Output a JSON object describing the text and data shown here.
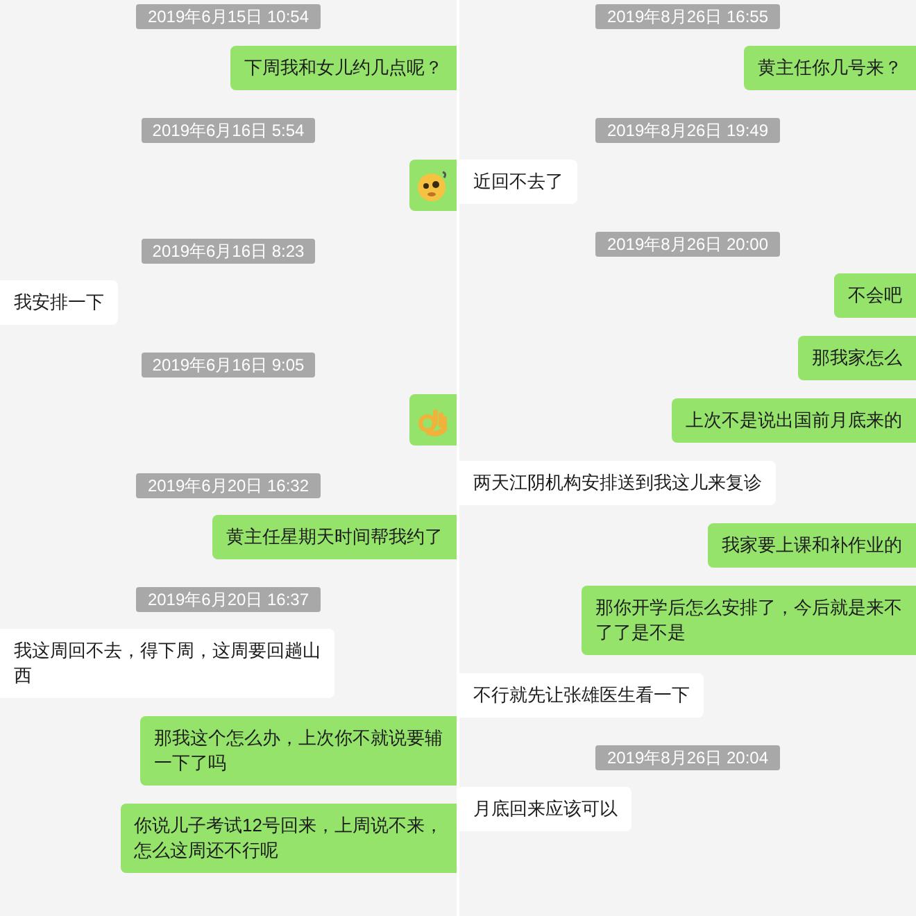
{
  "panels": [
    {
      "messages": [
        {
          "kind": "timestamp",
          "text": "2019年6月15日 10:54"
        },
        {
          "kind": "text",
          "outgoing": true,
          "lines": [
            "下周我和女儿约几点呢？"
          ]
        },
        {
          "kind": "timestamp",
          "text": "2019年6月16日 5:54"
        },
        {
          "kind": "face",
          "outgoing": true
        },
        {
          "kind": "timestamp",
          "text": "2019年6月16日 8:23"
        },
        {
          "kind": "text",
          "outgoing": false,
          "lines": [
            "我安排一下"
          ]
        },
        {
          "kind": "timestamp",
          "text": "2019年6月16日 9:05"
        },
        {
          "kind": "hand",
          "outgoing": true
        },
        {
          "kind": "timestamp",
          "text": "2019年6月20日 16:32"
        },
        {
          "kind": "text",
          "outgoing": true,
          "lines": [
            "黄主任星期天时间帮我约了"
          ]
        },
        {
          "kind": "timestamp",
          "text": "2019年6月20日 16:37"
        },
        {
          "kind": "text",
          "outgoing": false,
          "lines": [
            "我这周回不去，得下周，这周要回趟山",
            "西"
          ]
        },
        {
          "kind": "text",
          "outgoing": true,
          "lines": [
            "那我这个怎么办，上次你不就说要辅",
            "一下了吗"
          ]
        },
        {
          "kind": "text",
          "outgoing": true,
          "lines": [
            "你说儿子考试12号回来，上周说不来，",
            "怎么这周还不行呢"
          ]
        }
      ]
    },
    {
      "messages": [
        {
          "kind": "timestamp",
          "text": "2019年8月26日 16:55"
        },
        {
          "kind": "text",
          "outgoing": true,
          "lines": [
            "黄主任你几号来？"
          ]
        },
        {
          "kind": "timestamp",
          "text": "2019年8月26日 19:49"
        },
        {
          "kind": "text",
          "outgoing": false,
          "lines": [
            "近回不去了"
          ]
        },
        {
          "kind": "timestamp",
          "text": "2019年8月26日 20:00"
        },
        {
          "kind": "text",
          "outgoing": true,
          "lines": [
            "不会吧"
          ]
        },
        {
          "kind": "text",
          "outgoing": true,
          "lines": [
            "那我家怎么"
          ]
        },
        {
          "kind": "text",
          "outgoing": true,
          "lines": [
            "上次不是说出国前月底来的"
          ]
        },
        {
          "kind": "text",
          "outgoing": false,
          "lines": [
            "两天江阴机构安排送到我这儿来复诊"
          ]
        },
        {
          "kind": "text",
          "outgoing": true,
          "lines": [
            "我家要上课和补作业的"
          ]
        },
        {
          "kind": "text",
          "outgoing": true,
          "lines": [
            "那你开学后怎么安排了，今后就是来不",
            "了了是不是"
          ]
        },
        {
          "kind": "text",
          "outgoing": false,
          "lines": [
            "不行就先让张雄医生看一下"
          ]
        },
        {
          "kind": "timestamp",
          "text": "2019年8月26日 20:04"
        },
        {
          "kind": "text",
          "outgoing": false,
          "lines": [
            "月底回来应该可以"
          ]
        }
      ]
    }
  ]
}
